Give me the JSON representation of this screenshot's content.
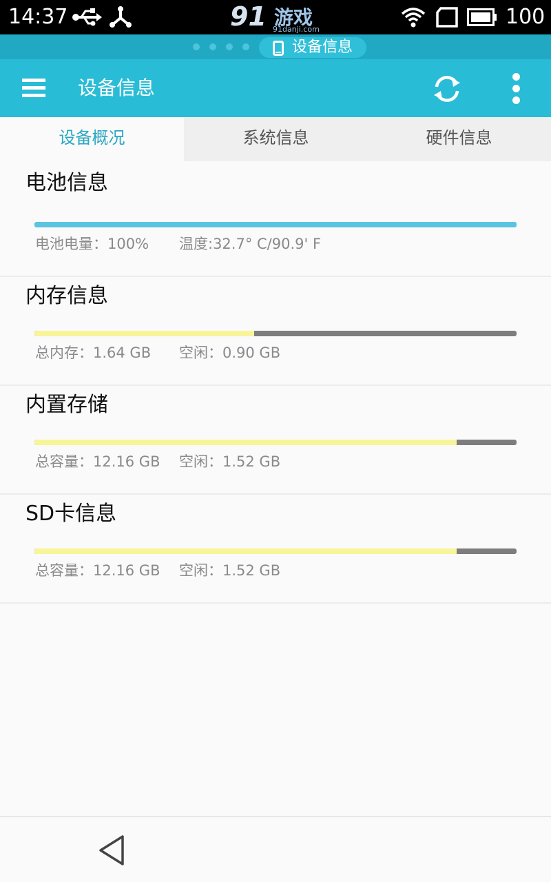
{
  "status_bar": {
    "time": "14:37",
    "battery_text": "100",
    "icons": [
      "usb-icon",
      "tether-icon",
      "wifi-icon",
      "sim-icon",
      "battery-icon"
    ]
  },
  "watermark": {
    "logo_number": "91",
    "logo_text": "游戏",
    "logo_sub": "91danji.com"
  },
  "floating_indicator": {
    "label": "设备信息",
    "icon": "phone-icon"
  },
  "app_bar": {
    "title": "设备信息",
    "icons": [
      "menu-icon",
      "refresh-icon",
      "more-icon"
    ]
  },
  "tabs": [
    {
      "label": "设备概况",
      "active": true
    },
    {
      "label": "系统信息",
      "active": false
    },
    {
      "label": "硬件信息",
      "active": false
    }
  ],
  "sections": [
    {
      "title": "电池信息",
      "bar_fraction": 1.0,
      "bar_color": "#5bc4e0",
      "stat1": "电池电量：100%",
      "stat2": "温度:32.7° C/90.9' F"
    },
    {
      "title": "内存信息",
      "bar_fraction": 0.456,
      "bar_color": "#f7f598",
      "stat1": "总内存：1.64 GB",
      "stat2": "空闲：0.90 GB"
    },
    {
      "title": "内置存储",
      "bar_fraction": 0.876,
      "bar_color": "#f7f598",
      "stat1": "总容量：12.16 GB",
      "stat2": "空闲：1.52 GB"
    },
    {
      "title": "SD卡信息",
      "bar_fraction": 0.876,
      "bar_color": "#f7f598",
      "stat1": "总容量：12.16 GB",
      "stat2": "空闲：1.52 GB"
    }
  ],
  "colors": {
    "accent": "#29bcd6",
    "tab_active_text": "#2aa7c2",
    "bar_used_track": "#7d7d7d"
  },
  "nav_bar": {
    "icons": [
      "back-icon"
    ]
  }
}
